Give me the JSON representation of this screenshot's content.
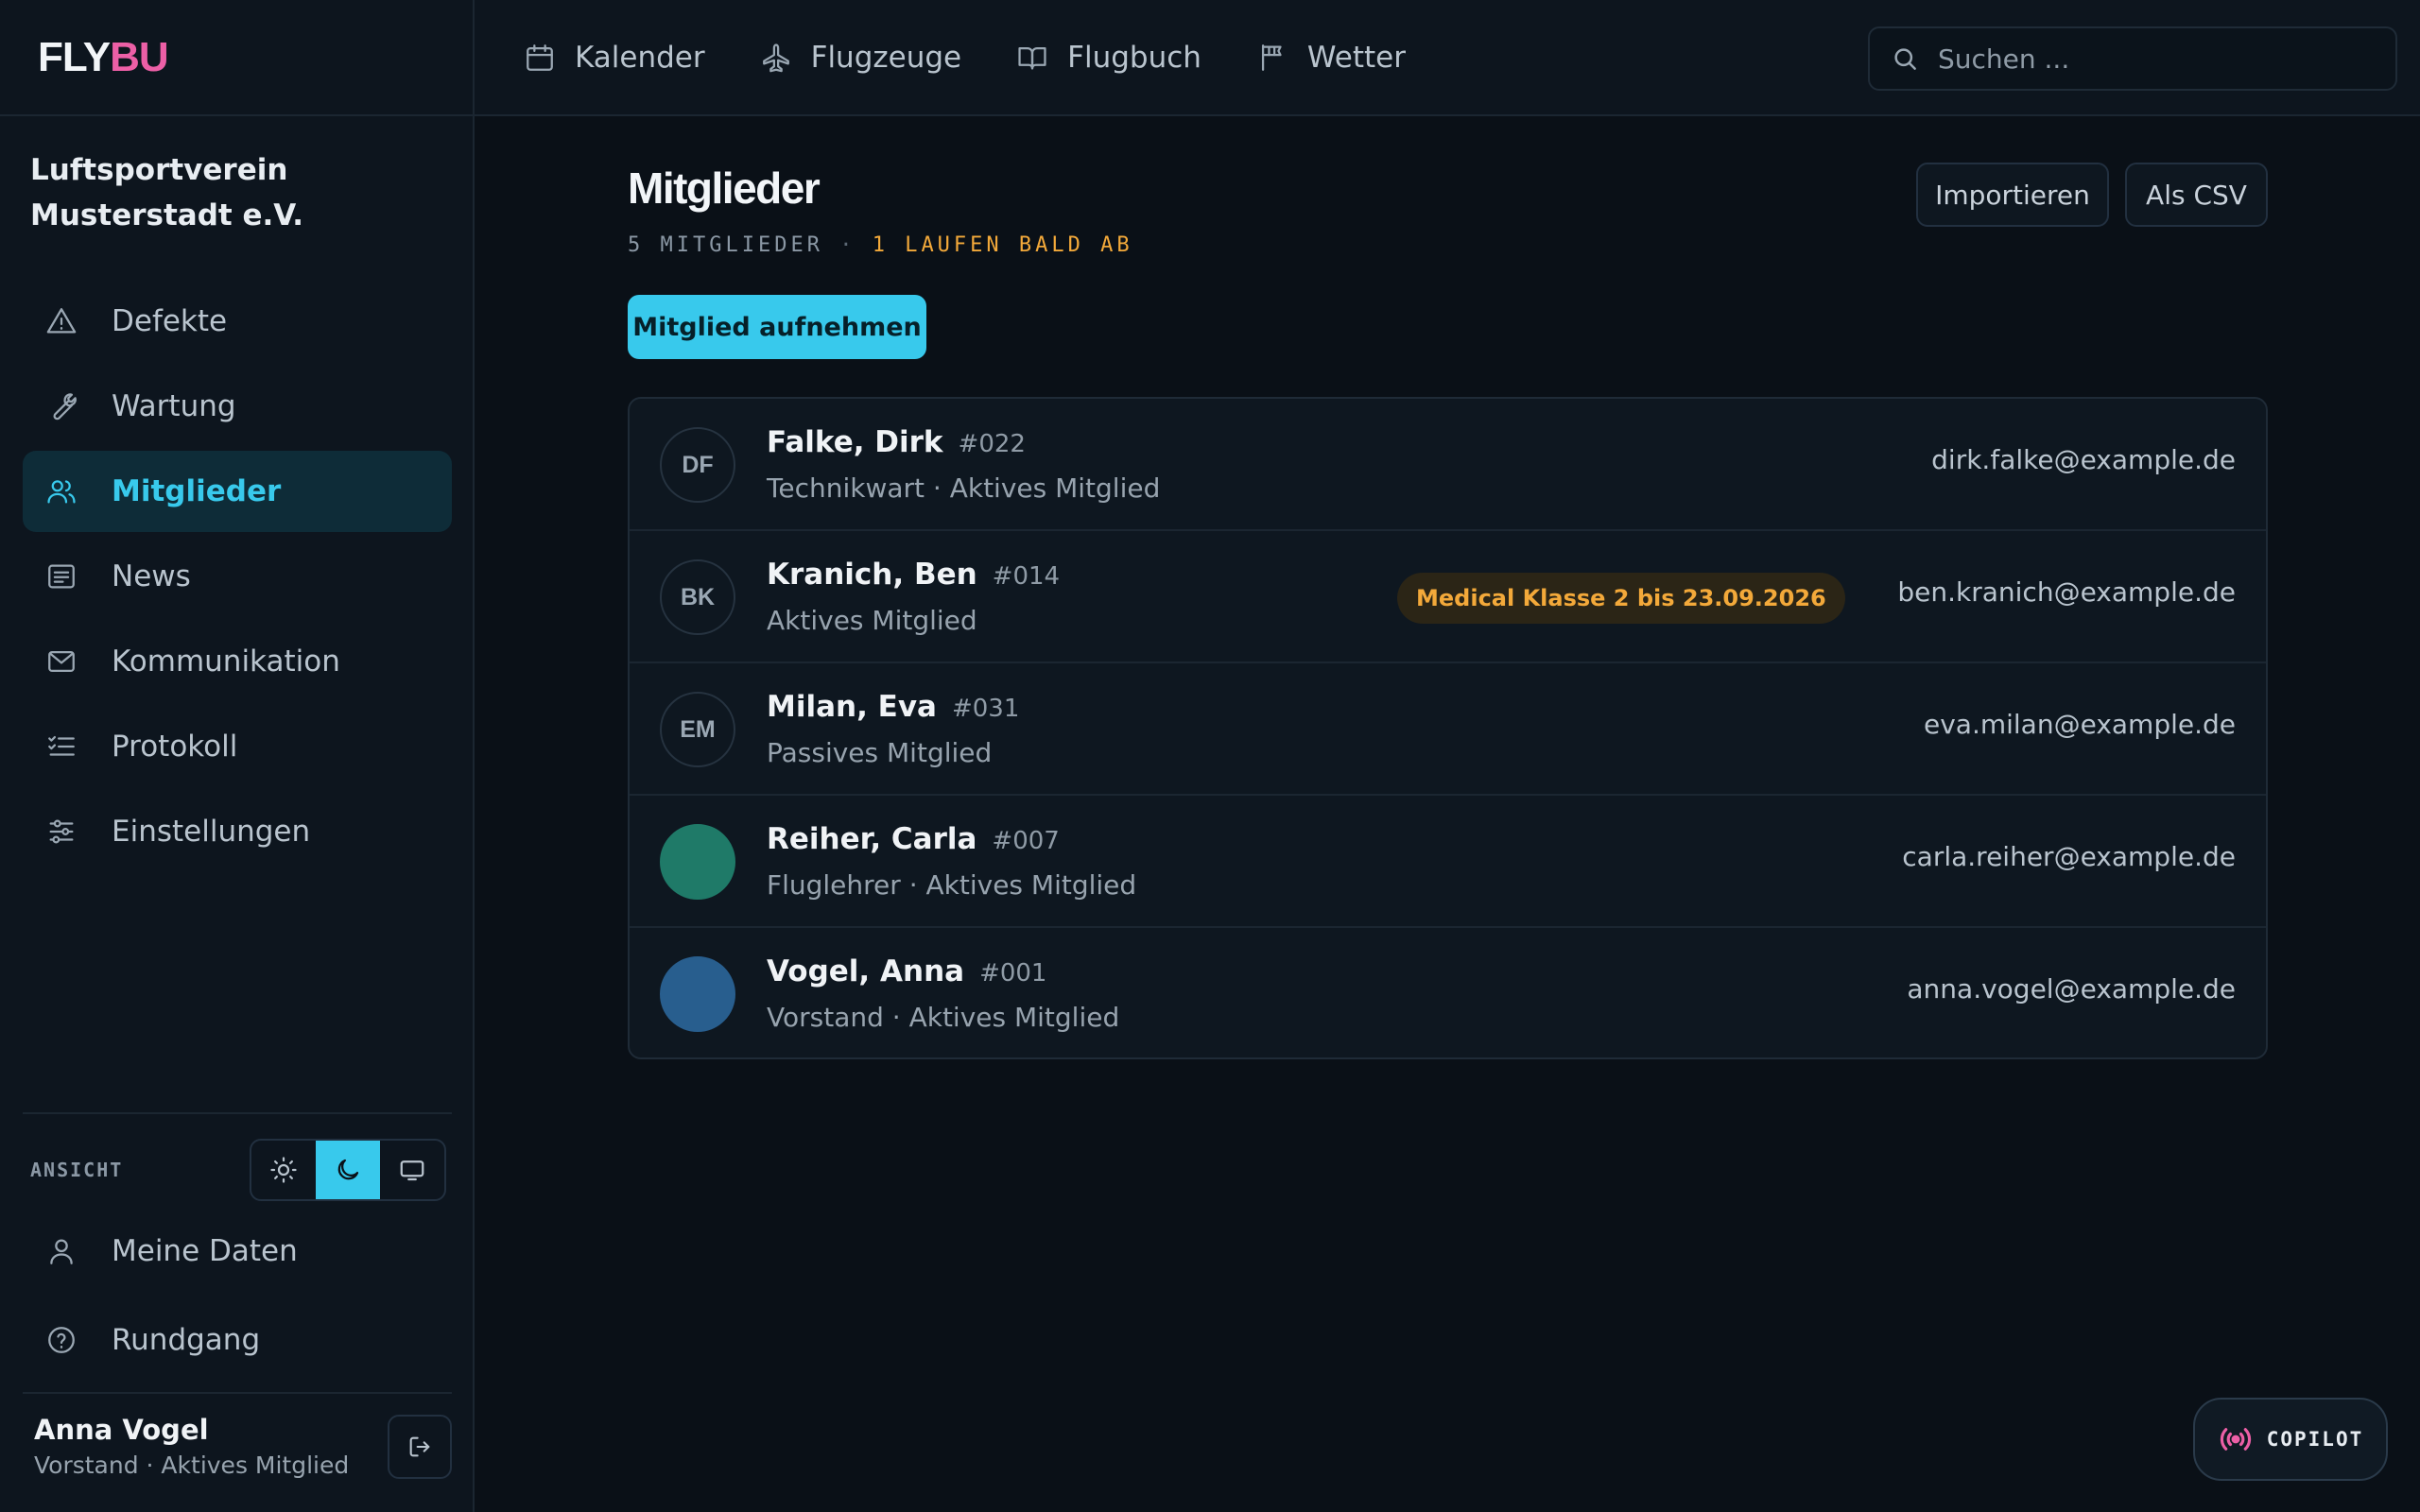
{
  "brand": {
    "part1": "FLY",
    "part2": "BU",
    "color_primary": "#f2f5f8",
    "color_accent": "#ec5fa6"
  },
  "org_name": "Luftsportverein Musterstadt e.V.",
  "topnav": [
    {
      "label": "Kalender",
      "icon": "calendar-icon"
    },
    {
      "label": "Flugzeuge",
      "icon": "plane-icon"
    },
    {
      "label": "Flugbuch",
      "icon": "book-icon"
    },
    {
      "label": "Wetter",
      "icon": "windsock-icon"
    }
  ],
  "search": {
    "placeholder": "Suchen ...",
    "value": ""
  },
  "sidebar": {
    "items": [
      {
        "label": "Defekte",
        "icon": "warning-icon",
        "active": false
      },
      {
        "label": "Wartung",
        "icon": "wrench-icon",
        "active": false
      },
      {
        "label": "Mitglieder",
        "icon": "users-icon",
        "active": true
      },
      {
        "label": "News",
        "icon": "newspaper-icon",
        "active": false
      },
      {
        "label": "Kommunikation",
        "icon": "mail-icon",
        "active": false
      },
      {
        "label": "Protokoll",
        "icon": "checklist-icon",
        "active": false
      },
      {
        "label": "Einstellungen",
        "icon": "sliders-icon",
        "active": false
      }
    ],
    "view_label": "ANSICHT",
    "theme_options": [
      {
        "name": "light",
        "icon": "sun-icon",
        "active": false
      },
      {
        "name": "dark",
        "icon": "moon-icon",
        "active": true
      },
      {
        "name": "system",
        "icon": "monitor-icon",
        "active": false
      }
    ],
    "footer_items": [
      {
        "label": "Meine Daten",
        "icon": "user-icon"
      },
      {
        "label": "Rundgang",
        "icon": "help-circle-icon"
      }
    ],
    "user": {
      "name": "Anna Vogel",
      "role": "Vorstand · Aktives Mitglied"
    }
  },
  "main": {
    "title": "Mitglieder",
    "count_text": "5 MITGLIEDER",
    "separator": "·",
    "expiring_text": "1 LAUFEN BALD AB",
    "buttons": {
      "import": "Importieren",
      "csv": "Als CSV",
      "add": "Mitglied aufnehmen"
    },
    "members": [
      {
        "initials": "DF",
        "name": "Falke, Dirk",
        "number": "#022",
        "role": "Technikwart · Aktives Mitglied",
        "email": "dirk.falke@example.de",
        "badge": "",
        "avatar_color": ""
      },
      {
        "initials": "BK",
        "name": "Kranich, Ben",
        "number": "#014",
        "role": "Aktives Mitglied",
        "email": "ben.kranich@example.de",
        "badge": "Medical Klasse 2 bis 23.09.2026",
        "avatar_color": ""
      },
      {
        "initials": "EM",
        "name": "Milan, Eva",
        "number": "#031",
        "role": "Passives Mitglied",
        "email": "eva.milan@example.de",
        "badge": "",
        "avatar_color": ""
      },
      {
        "initials": "",
        "name": "Reiher, Carla",
        "number": "#007",
        "role": "Fluglehrer · Aktives Mitglied",
        "email": "carla.reiher@example.de",
        "badge": "",
        "avatar_color": "#1f7a68"
      },
      {
        "initials": "",
        "name": "Vogel, Anna",
        "number": "#001",
        "role": "Vorstand · Aktives Mitglied",
        "email": "anna.vogel@example.de",
        "badge": "",
        "avatar_color": "#285e8e"
      }
    ]
  },
  "copilot": {
    "label": "COPILOT",
    "icon": "broadcast-icon"
  },
  "colors": {
    "accent": "#38c9ec",
    "warning": "#f3a93a",
    "background": "#0a1017",
    "panel": "#0d151e"
  }
}
